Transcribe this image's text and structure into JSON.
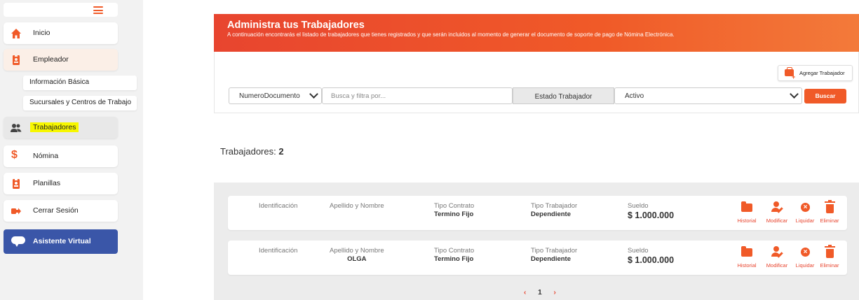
{
  "sidebar": {
    "items": [
      {
        "label": "Inicio",
        "icon": "home-icon"
      },
      {
        "label": "Empleador",
        "icon": "badge-icon"
      },
      {
        "label": "Trabajadores",
        "icon": "users-icon"
      },
      {
        "label": "Nómina",
        "icon": "dollar-icon"
      },
      {
        "label": "Planillas",
        "icon": "clipboard-icon"
      },
      {
        "label": "Cerrar Sesión",
        "icon": "logout-icon"
      }
    ],
    "subitems": [
      {
        "label": "Información Básica"
      },
      {
        "label": "Sucursales y Centros de Trabajo"
      }
    ],
    "assistant_label": "Asistente Virtual"
  },
  "header": {
    "title": "Administra tus Trabajadores",
    "subtitle": "A continuación encontrarás el listado de trabajadores que tienes registrados y que serán incluidos al momento de generar el documento de soporte de pago de Nómina Electrónica."
  },
  "toolbar": {
    "add_label": "Agregar Trabajador",
    "filter_field": "NumeroDocumento",
    "search_placeholder": "Busca y filtra por...",
    "estado_label": "Estado Trabajador",
    "estado_value": "Activo",
    "search_button": "Buscar"
  },
  "count": {
    "label": "Trabajadores:",
    "value": "2"
  },
  "columns": {
    "id": "Identificación",
    "name": "Apellido y Nombre",
    "contract": "Tipo Contrato",
    "worker_type": "Tipo Trabajador",
    "salary": "Sueldo"
  },
  "workers": [
    {
      "id": "",
      "name": "",
      "contract": "Termino Fijo",
      "worker_type": "Dependiente",
      "salary": "$ 1.000.000"
    },
    {
      "id": "",
      "name": "OLGA",
      "contract": "Termino Fijo",
      "worker_type": "Dependiente",
      "salary": "$ 1.000.000"
    }
  ],
  "actions": {
    "history": "Historial",
    "edit": "Modificar",
    "settle": "Liquidar",
    "delete": "Eliminar"
  },
  "pagination": {
    "current": "1",
    "prev": "‹",
    "next": "›"
  },
  "colors": {
    "accent": "#f05a28",
    "assistant": "#3a56a8",
    "highlight": "#f7f700"
  }
}
